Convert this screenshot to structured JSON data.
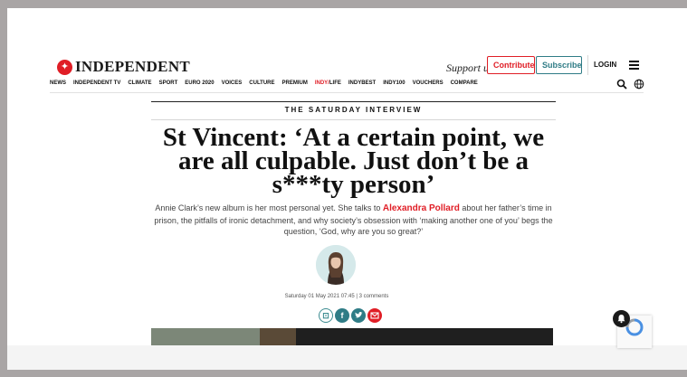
{
  "header": {
    "logo_text": "INDEPENDENT",
    "support_text": "Support us",
    "contribute_label": "Contribute",
    "subscribe_label": "Subscribe",
    "login_label": "LOGIN"
  },
  "nav": {
    "items": [
      {
        "label": "NEWS"
      },
      {
        "label": "INDEPENDENT TV"
      },
      {
        "label": "CLIMATE"
      },
      {
        "label": "SPORT"
      },
      {
        "label": "EURO 2020"
      },
      {
        "label": "VOICES"
      },
      {
        "label": "CULTURE"
      },
      {
        "label": "PREMIUM"
      },
      {
        "label_red": "INDY/",
        "label_rest": "LIFE"
      },
      {
        "label": "INDYBEST"
      },
      {
        "label": "INDY100"
      },
      {
        "label": "VOUCHERS"
      },
      {
        "label": "COMPARE"
      }
    ]
  },
  "article": {
    "kicker": "THE SATURDAY INTERVIEW",
    "headline": "St Vincent: ‘At a certain point, we are all culpable. Just don’t be a s***ty person’",
    "standfirst_before": "Annie Clark’s new album is her most personal yet. She talks to ",
    "author": "Alexandra Pollard",
    "standfirst_after": " about her father’s time in prison, the pitfalls of ironic detachment, and why society’s obsession with ‘making another one of you’ begs the question, ‘God, why are you so great?’",
    "date": "Saturday 01 May 2021 07:45",
    "separator": "|",
    "comments": "3 comments"
  },
  "colors": {
    "brand_red": "#e01e26",
    "teal": "#2f7c86",
    "outer_background": "#a9a5a5"
  }
}
